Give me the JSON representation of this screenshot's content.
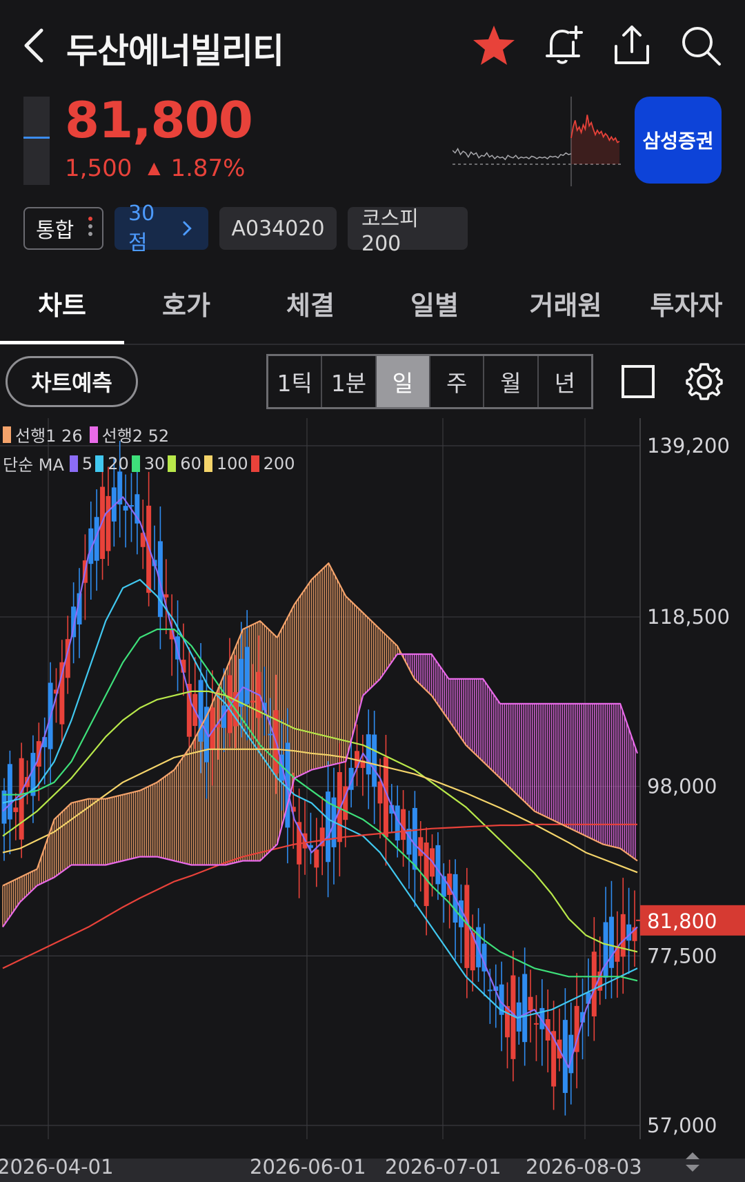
{
  "header": {
    "title": "두산에너빌리티",
    "back_icon": "chevron-left-icon",
    "icons": [
      "star-icon",
      "bell-plus-icon",
      "share-icon",
      "search-icon"
    ],
    "favorite_color": "#e8423a"
  },
  "quote": {
    "price": "81,800",
    "change": "1,500",
    "change_arrow": "▲",
    "change_pct": "1.87%",
    "up_color": "#e8423a",
    "broker": "삼성증권",
    "broker_color": "#0d43d8"
  },
  "chips": {
    "market": "통합",
    "score": "30점",
    "code": "A034020",
    "index": "코스피200"
  },
  "tabs": [
    "차트",
    "호가",
    "체결",
    "일별",
    "거래원",
    "투자자"
  ],
  "toolbar": {
    "predict": "차트예측",
    "periods": [
      "1틱",
      "1분",
      "일",
      "주",
      "월",
      "년"
    ],
    "selected_period": "일",
    "icons": [
      "square-icon",
      "gear-icon"
    ]
  },
  "legend": {
    "ichimoku": [
      {
        "label": "선행1 26",
        "color": "#f4a36b"
      },
      {
        "label": "선행2 52",
        "color": "#e86ae8"
      }
    ],
    "ma_prefix": "단순 MA",
    "ma": [
      {
        "label": "5",
        "color": "#8b6cf6"
      },
      {
        "label": "20",
        "color": "#41c8f0"
      },
      {
        "label": "30",
        "color": "#3ee07a"
      },
      {
        "label": "60",
        "color": "#b8e84a"
      },
      {
        "label": "100",
        "color": "#f4d46a"
      },
      {
        "label": "200",
        "color": "#e8423a"
      }
    ]
  },
  "chart_data": {
    "type": "line",
    "y_ticks": [
      "139,200",
      "118,500",
      "98,000",
      "77,500",
      "57,000"
    ],
    "y_values": [
      139200,
      118500,
      98000,
      77500,
      57000
    ],
    "current_label": "81,800",
    "current_value": 81800,
    "x_ticks": [
      "2026-04-01",
      "2026-06-01",
      "2026-07-01",
      "2026-08-03"
    ],
    "ylim": [
      57000,
      139200
    ],
    "up_color": "#e8423a",
    "down_color": "#2f8cf0",
    "series": [
      {
        "name": "5",
        "color": "#8b6cf6",
        "values": [
          95000,
          97000,
          101000,
          108000,
          116000,
          126000,
          131000,
          133000,
          130000,
          124000,
          116000,
          108000,
          104000,
          107000,
          110000,
          109000,
          103000,
          94000,
          90000,
          92000,
          97000,
          102000,
          99000,
          94000,
          91000,
          89000,
          86000,
          82000,
          77000,
          72000,
          70000,
          71000,
          68000,
          64000,
          71000,
          76000,
          79000,
          81000
        ]
      },
      {
        "name": "20",
        "color": "#41c8f0",
        "values": [
          96000,
          96500,
          98000,
          101000,
          106000,
          112000,
          118000,
          122000,
          123000,
          121000,
          118000,
          114000,
          110000,
          108000,
          105000,
          102000,
          99000,
          97000,
          96000,
          94000,
          93000,
          92000,
          90000,
          87000,
          84000,
          81000,
          78000,
          75000,
          73000,
          71000,
          70000,
          70500,
          71000,
          72000,
          73000,
          74000,
          75000,
          76000
        ]
      },
      {
        "name": "30",
        "color": "#3ee07a",
        "values": [
          97000,
          97000,
          97500,
          98500,
          101000,
          105000,
          109000,
          113000,
          116000,
          117000,
          117000,
          115000,
          112000,
          109000,
          106000,
          103000,
          101000,
          99000,
          97500,
          96000,
          95000,
          94000,
          92500,
          90500,
          88500,
          86000,
          84000,
          81500,
          79500,
          78000,
          77000,
          76000,
          75500,
          75000,
          75000,
          75000,
          75000,
          74500
        ]
      },
      {
        "name": "60",
        "color": "#b8e84a",
        "values": [
          92000,
          93500,
          95000,
          97000,
          99000,
          101500,
          104000,
          106000,
          107500,
          108500,
          109000,
          109500,
          109500,
          109000,
          108000,
          107000,
          106000,
          105000,
          104500,
          104000,
          103500,
          103000,
          102000,
          101000,
          100000,
          98500,
          97000,
          95500,
          93500,
          91500,
          89500,
          87500,
          85000,
          82000,
          80000,
          79000,
          78500,
          78000
        ]
      },
      {
        "name": "100",
        "color": "#f4d46a",
        "values": [
          90000,
          90500,
          91500,
          92500,
          94000,
          95500,
          97000,
          98500,
          99500,
          100500,
          101500,
          102000,
          102500,
          102500,
          102500,
          102500,
          102500,
          102300,
          102000,
          101800,
          101500,
          101000,
          100500,
          100000,
          99500,
          98800,
          98000,
          97200,
          96300,
          95400,
          94400,
          93400,
          92300,
          91200,
          90000,
          89200,
          88400,
          87600
        ]
      },
      {
        "name": "200",
        "color": "#e8423a",
        "values": [
          76000,
          77000,
          78000,
          79000,
          80000,
          81000,
          82200,
          83400,
          84500,
          85500,
          86500,
          87200,
          88000,
          88800,
          89500,
          90000,
          90500,
          91000,
          91300,
          91600,
          91900,
          92100,
          92300,
          92500,
          92700,
          92900,
          93000,
          93100,
          93200,
          93300,
          93300,
          93400,
          93400,
          93400,
          93400,
          93400,
          93400,
          93400
        ]
      },
      {
        "name": "선행1 26",
        "color": "#f4a36b",
        "values": [
          86000,
          87000,
          88000,
          94000,
          96000,
          96500,
          96500,
          97000,
          97500,
          98500,
          100000,
          103000,
          107000,
          112000,
          117000,
          118000,
          116000,
          120000,
          123000,
          125000,
          121000,
          119000,
          117000,
          115000,
          111000,
          109000,
          106000,
          103000,
          101000,
          99000,
          97000,
          95000,
          94000,
          93000,
          92000,
          91000,
          90500,
          89000
        ]
      },
      {
        "name": "선행2 52",
        "color": "#e86ae8",
        "values": [
          81000,
          84000,
          86000,
          87000,
          88500,
          88500,
          88500,
          89000,
          89500,
          89500,
          89000,
          88500,
          88500,
          88500,
          89000,
          89000,
          91000,
          99000,
          100000,
          100500,
          101000,
          109000,
          111000,
          114000,
          114000,
          114000,
          111000,
          111000,
          111000,
          108000,
          108000,
          108000,
          108000,
          108000,
          108000,
          108000,
          108000,
          102000
        ]
      }
    ]
  }
}
